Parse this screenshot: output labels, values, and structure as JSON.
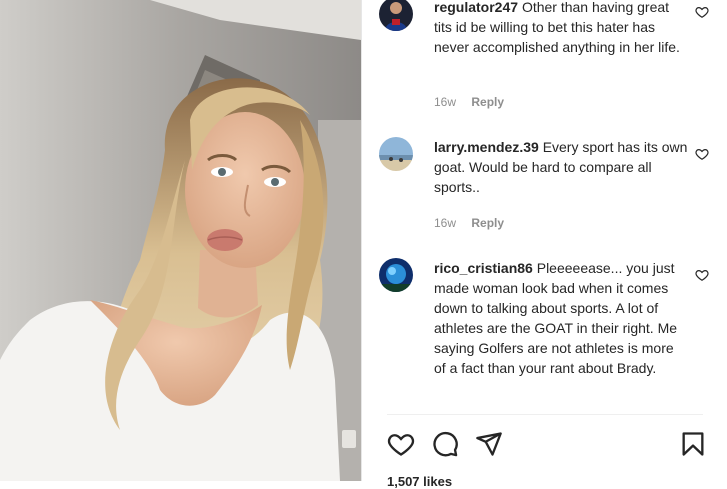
{
  "comments": [
    {
      "username": "regulator247",
      "text": "Other than having great tits id be willing to bet this hater has never accomplished anything in her life.",
      "time": "16w",
      "reply_label": "Reply"
    },
    {
      "username": "larry.mendez.39",
      "text": "Every sport has its own goat. Would be hard to compare all sports..",
      "time": "16w",
      "reply_label": "Reply"
    },
    {
      "username": "rico_cristian86",
      "text": "Pleeeeease... you just made woman look bad when it comes down to talking about sports. A lot of athletes are the GOAT in their right. Me saying Golfers are not athletes is more of a fact than your rant about Brady."
    }
  ],
  "actions": {
    "like": "heart-icon",
    "comment": "comment-bubble-icon",
    "share": "paper-plane-icon",
    "save": "bookmark-icon"
  },
  "likes_partial": "1,507 likes"
}
